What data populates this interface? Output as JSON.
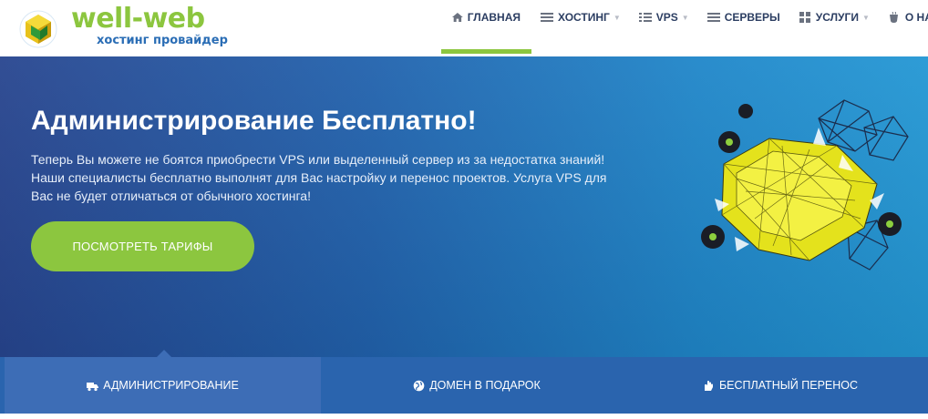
{
  "logo": {
    "title": "well-web",
    "subtitle": "хостинг провайдер"
  },
  "nav": {
    "items": [
      {
        "label": "ГЛАВНАЯ",
        "icon": "home-icon",
        "active": true,
        "dropdown": false
      },
      {
        "label": "ХОСТИНГ",
        "icon": "list-icon",
        "active": false,
        "dropdown": true
      },
      {
        "label": "VPS",
        "icon": "grid-list-icon",
        "active": false,
        "dropdown": true
      },
      {
        "label": "СЕРВЕРЫ",
        "icon": "servers-icon",
        "active": false,
        "dropdown": false
      },
      {
        "label": "УСЛУГИ",
        "icon": "puzzle-icon",
        "active": false,
        "dropdown": true
      },
      {
        "label": "О НАС",
        "icon": "coffee-icon",
        "active": false,
        "dropdown": true
      }
    ]
  },
  "hero": {
    "title_bold": "Администрирование",
    "title_light": "Бесплатно!",
    "description": "Теперь Вы можете не боятся приобрести VPS или выделенный сервер из за недостатка знаний! Наши специалисты бесплатно выполнят для Вас настройку и перенос проектов. Услуга VPS для Вас не будет отличаться от обычного хостинга!",
    "button_label": "ПОСМОТРЕТЬ ТАРИФЫ"
  },
  "tabs": [
    {
      "label": "АДМИНИСТРИРОВАНИЕ",
      "icon": "truck-icon",
      "active": true
    },
    {
      "label": "ДОМЕН В ПОДАРОК",
      "icon": "globe-icon",
      "active": false
    },
    {
      "label": "БЕСПЛАТНЫЙ ПЕРЕНОС",
      "icon": "hand-icon",
      "active": false
    }
  ],
  "colors": {
    "brand_green": "#8cc63f",
    "brand_blue": "#2a6db5",
    "nav_text": "#2c3e62",
    "hero_dark": "#27458f",
    "hero_light": "#2397d4"
  }
}
